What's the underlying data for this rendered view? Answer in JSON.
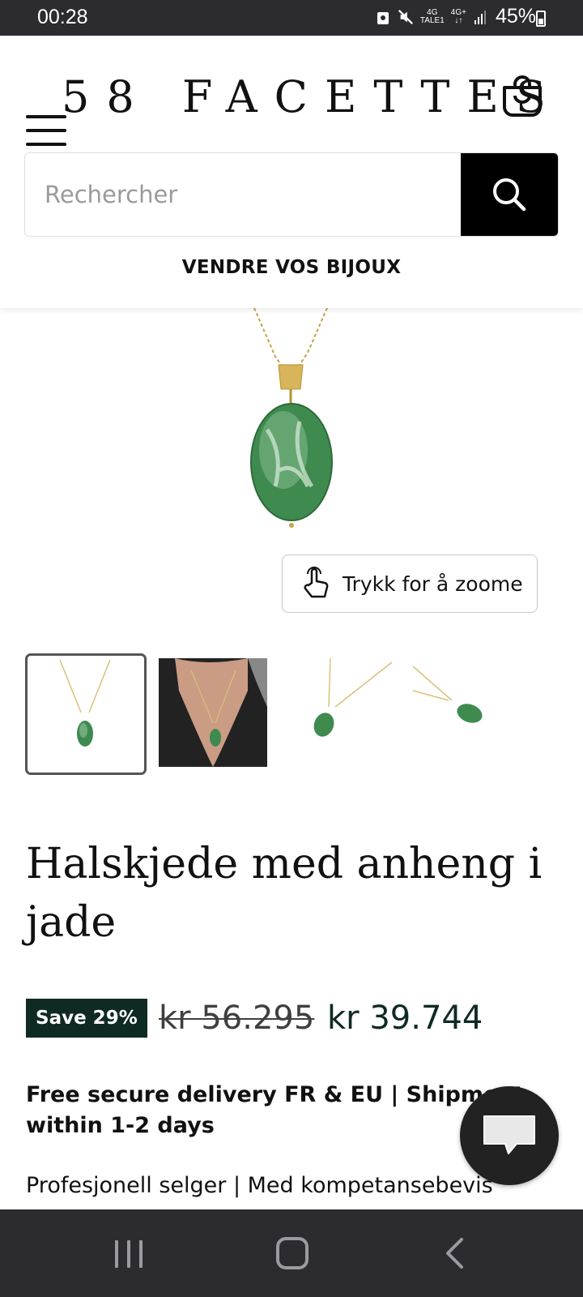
{
  "status_bar": {
    "time": "00:28",
    "net_top": "4G",
    "net_sub": "TALE1",
    "net2_top": "4G+",
    "battery": "45%"
  },
  "header": {
    "logo": "58 FACETTES",
    "search_placeholder": "Rechercher",
    "sell_link": "VENDRE VOS BIJOUX"
  },
  "gallery": {
    "zoom_label": "Trykk for å zoome",
    "thumbnail_count": 4,
    "selected_index": 0,
    "jade_color": "#3f8a4f"
  },
  "product": {
    "title": "Halskjede med anheng i jade",
    "save_badge": "Save 29%",
    "compare_price": "kr 56.295",
    "price": "kr 39.744",
    "delivery": "Free secure delivery FR & EU | Shipment within 1-2 days",
    "seller": "Profesjonell selger | Med kompetansebevis"
  },
  "colors": {
    "accent": "#0f2a24",
    "dark_bar": "#2c2c30"
  }
}
